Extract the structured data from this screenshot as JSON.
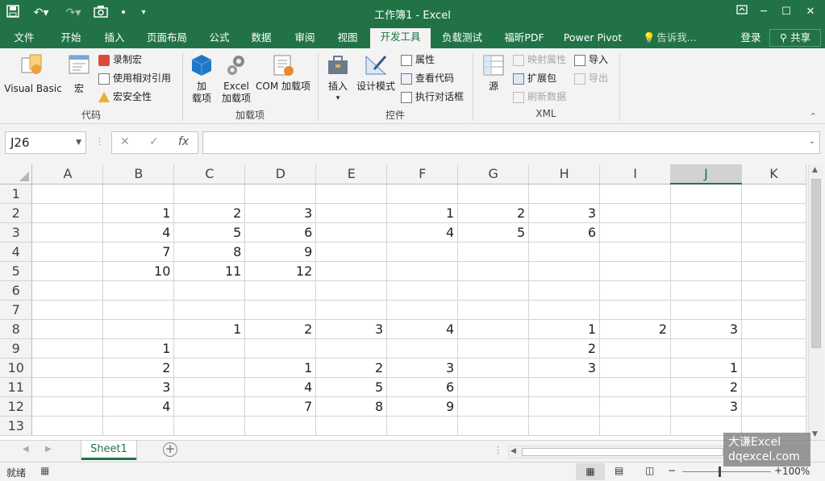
{
  "window": {
    "title": "工作簿1 - Excel",
    "brand_color": "#217346",
    "buttons": [
      "restore-ribbon-icon",
      "minimize-icon",
      "maximize-icon",
      "close-icon"
    ]
  },
  "tabs": [
    {
      "label": "文件"
    },
    {
      "label": "开始"
    },
    {
      "label": "插入"
    },
    {
      "label": "页面布局"
    },
    {
      "label": "公式"
    },
    {
      "label": "数据"
    },
    {
      "label": "审阅"
    },
    {
      "label": "视图"
    },
    {
      "label": "开发工具",
      "active": true
    },
    {
      "label": "负载测试"
    },
    {
      "label": "福昕PDF"
    },
    {
      "label": "Power Pivot"
    }
  ],
  "tell_me": "告诉我...",
  "signin": "登录",
  "share": "共享",
  "ribbon": {
    "code": {
      "label": "代码",
      "vb": "Visual Basic",
      "macro": "宏",
      "record": "录制宏",
      "relative": "使用相对引用",
      "security": "宏安全性"
    },
    "addins": {
      "label": "加载项",
      "addin_1": "加",
      "addin_2": "载项",
      "excel_1": "Excel",
      "excel_2": "加载项",
      "com": "COM 加载项"
    },
    "controls": {
      "label": "控件",
      "insert": "插入",
      "design": "设计模式",
      "properties": "属性",
      "view_code": "查看代码",
      "run_dialog": "执行对话框"
    },
    "xml": {
      "label": "XML",
      "source": "源",
      "map_props": "映射属性",
      "expansion": "扩展包",
      "refresh": "刷新数据",
      "import": "导入",
      "export": "导出"
    }
  },
  "formula": {
    "namebox": "J26",
    "fx": "fx",
    "value": ""
  },
  "grid": {
    "columns": [
      "A",
      "B",
      "C",
      "D",
      "E",
      "F",
      "G",
      "H",
      "I",
      "J",
      "K"
    ],
    "selected_column": "J",
    "rows": [
      {
        "n": "1",
        "cells": [
          "",
          "",
          "",
          "",
          "",
          "",
          "",
          "",
          "",
          "",
          ""
        ]
      },
      {
        "n": "2",
        "cells": [
          "",
          "1",
          "2",
          "3",
          "",
          "1",
          "2",
          "3",
          "",
          "",
          ""
        ]
      },
      {
        "n": "3",
        "cells": [
          "",
          "4",
          "5",
          "6",
          "",
          "4",
          "5",
          "6",
          "",
          "",
          ""
        ]
      },
      {
        "n": "4",
        "cells": [
          "",
          "7",
          "8",
          "9",
          "",
          "",
          "",
          "",
          "",
          "",
          ""
        ]
      },
      {
        "n": "5",
        "cells": [
          "",
          "10",
          "11",
          "12",
          "",
          "",
          "",
          "",
          "",
          "",
          ""
        ]
      },
      {
        "n": "6",
        "cells": [
          "",
          "",
          "",
          "",
          "",
          "",
          "",
          "",
          "",
          "",
          ""
        ]
      },
      {
        "n": "7",
        "cells": [
          "",
          "",
          "",
          "",
          "",
          "",
          "",
          "",
          "",
          "",
          ""
        ]
      },
      {
        "n": "8",
        "cells": [
          "",
          "",
          "1",
          "2",
          "3",
          "4",
          "",
          "1",
          "2",
          "3",
          ""
        ]
      },
      {
        "n": "9",
        "cells": [
          "",
          "1",
          "",
          "",
          "",
          "",
          "",
          "2",
          "",
          "",
          ""
        ]
      },
      {
        "n": "10",
        "cells": [
          "",
          "2",
          "",
          "1",
          "2",
          "3",
          "",
          "3",
          "",
          "1",
          ""
        ]
      },
      {
        "n": "11",
        "cells": [
          "",
          "3",
          "",
          "4",
          "5",
          "6",
          "",
          "",
          "",
          "2",
          ""
        ]
      },
      {
        "n": "12",
        "cells": [
          "",
          "4",
          "",
          "7",
          "8",
          "9",
          "",
          "",
          "",
          "3",
          ""
        ]
      },
      {
        "n": "13",
        "cells": [
          "",
          "",
          "",
          "",
          "",
          "",
          "",
          "",
          "",
          "",
          ""
        ]
      }
    ]
  },
  "sheet": {
    "tab": "Sheet1"
  },
  "status": {
    "ready": "就绪",
    "zoom": "100%"
  },
  "watermark": {
    "line1": "大谦Excel",
    "line2": "dqexcel.com"
  }
}
